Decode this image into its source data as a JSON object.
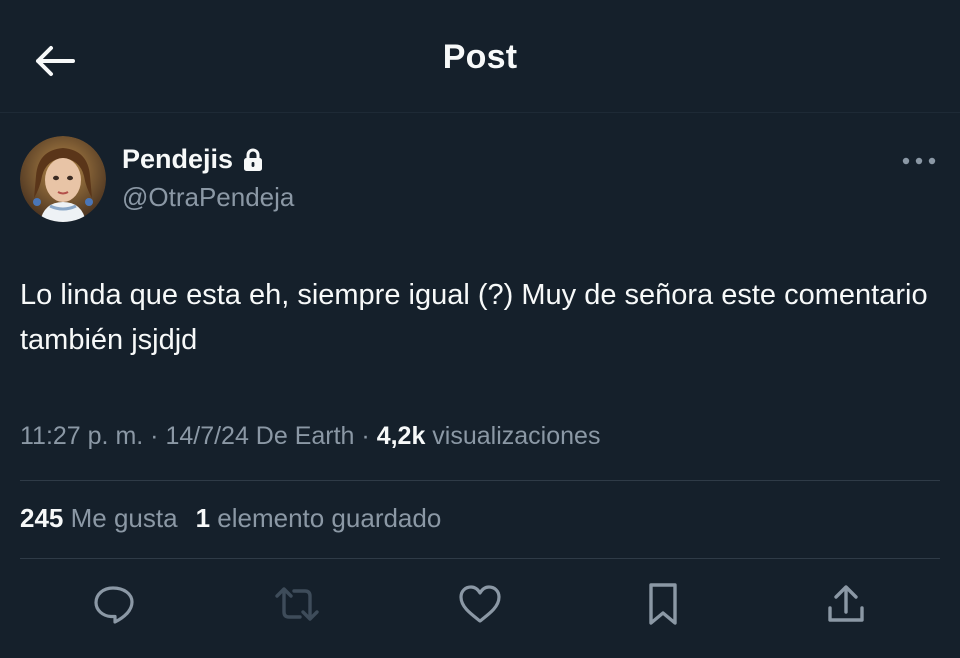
{
  "header": {
    "title": "Post",
    "back_icon": "arrow-left-icon"
  },
  "author": {
    "display_name": "Pendejis",
    "handle": "@OtraPendeja",
    "protected_icon": "lock-icon",
    "more_icon": "more-dots-icon"
  },
  "post": {
    "text": "Lo linda que esta eh, siempre igual (?) Muy de señora este comentario también jsjdjd"
  },
  "meta": {
    "time": "11:27 p. m.",
    "sep1": " · ",
    "date": "14/7/24",
    "source": " De Earth",
    "sep2": " · ",
    "views_count": "4,2k",
    "views_label": " visualizaciones"
  },
  "stats": {
    "likes_count": "245",
    "likes_label": " Me gusta",
    "bookmarks_count": "1",
    "bookmarks_label": " elemento guardado"
  },
  "actions": [
    "reply-icon",
    "repost-icon",
    "like-icon",
    "bookmark-icon",
    "share-icon"
  ],
  "colors": {
    "background": "#15202b",
    "primary_text": "#f7f9f9",
    "secondary_text": "#8b98a5",
    "divider": "#2f3b47"
  }
}
